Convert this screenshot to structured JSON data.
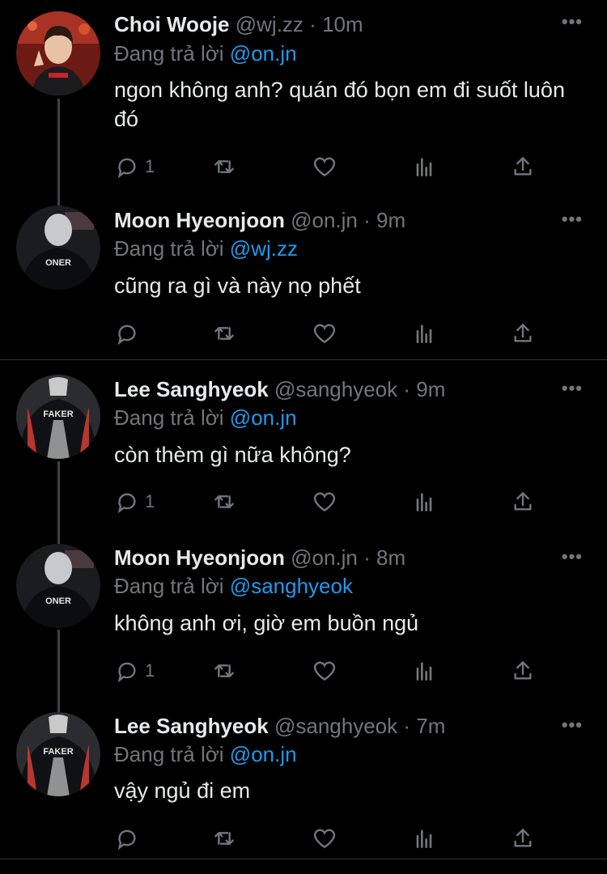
{
  "colors": {
    "background": "#000000",
    "text": "#e7e9ea",
    "muted": "#71767b",
    "accent": "#1d9bf0",
    "divider": "#2f3336"
  },
  "reply_prefix": "Đang trả lời",
  "more_icon": "ellipsis-icon",
  "tweets": [
    {
      "name": "Choi Wooje",
      "handle": "@wj.zz",
      "sep": "·",
      "time": "10m",
      "reply_to": "@on.jn",
      "body": "ngon không anh? quán đó bọn em đi suốt luôn đó",
      "replies": "1",
      "avatar_text": ""
    },
    {
      "name": "Moon Hyeonjoon",
      "handle": "@on.jn",
      "sep": "·",
      "time": "9m",
      "reply_to": "@wj.zz",
      "body": "cũng ra gì và này nọ phết",
      "replies": "",
      "avatar_text": "ONER"
    },
    {
      "name": "Lee Sanghyeok",
      "handle": "@sanghyeok",
      "sep": "·",
      "time": "9m",
      "reply_to": "@on.jn",
      "body": "còn thèm gì nữa không?",
      "replies": "1",
      "avatar_text": "FAKER"
    },
    {
      "name": "Moon Hyeonjoon",
      "handle": "@on.jn",
      "sep": "·",
      "time": "8m",
      "reply_to": "@sanghyeok",
      "body": "không anh ơi, giờ em buồn ngủ",
      "replies": "1",
      "avatar_text": "ONER"
    },
    {
      "name": "Lee Sanghyeok",
      "handle": "@sanghyeok",
      "sep": "·",
      "time": "7m",
      "reply_to": "@on.jn",
      "body": "vậy ngủ đi em",
      "replies": "",
      "avatar_text": "FAKER"
    }
  ]
}
